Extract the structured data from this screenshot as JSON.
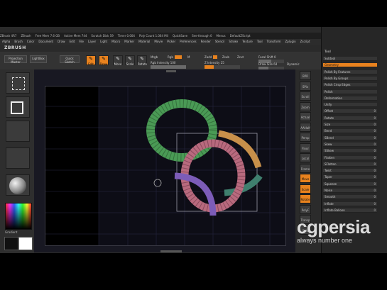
{
  "app": {
    "title_parts": [
      "ZBrush 4R7",
      "ZBrush",
      "Free Mem 7.6 GB",
      "Active Mem 744",
      "Scratch Disk 59",
      "Timer 0.004",
      "Poly Count 1.064 Mil",
      "QuickSave",
      "See-through 0",
      "Menus",
      "DefaultZScript"
    ],
    "logo": "ZBRUSH",
    "menus": [
      "Alpha",
      "Brush",
      "Color",
      "Document",
      "Draw",
      "Edit",
      "File",
      "Layer",
      "Light",
      "Macro",
      "Marker",
      "Material",
      "Movie",
      "Picker",
      "Preferences",
      "Render",
      "Stencil",
      "Stroke",
      "Texture",
      "Tool",
      "Transform",
      "Zplugin",
      "Zscript"
    ]
  },
  "top_shelf": {
    "projection_master": "Projection Master",
    "lightbox": "LightBox",
    "quick_sketch": "Quick Sketch",
    "tools": [
      {
        "label": "Edit",
        "active": true
      },
      {
        "label": "Draw",
        "active": true
      },
      {
        "label": "Move",
        "active": false
      },
      {
        "label": "Scale",
        "active": false
      },
      {
        "label": "Rotate",
        "active": false
      }
    ],
    "mrgb": "Mrgb",
    "rgb": "Rgb",
    "m": "M",
    "rgb_intensity": "Rgb Intensity 100",
    "zadd": "Zadd",
    "zsub": "Zsub",
    "zcut": "Zcut",
    "z_intensity": "Z Intensity 25",
    "focal_shift": "Focal Shift 0",
    "draw_size": "Draw Size 64",
    "dynamic": "Dynamic"
  },
  "right_tray": {
    "header": "Tool",
    "rows": [
      {
        "label": "Subtool",
        "orange": false,
        "value": ""
      },
      {
        "label": "Geometry",
        "orange": true,
        "value": ""
      },
      {
        "label": "Polish By Features",
        "orange": false,
        "value": ""
      },
      {
        "label": "Polish By Groups",
        "orange": false,
        "value": ""
      },
      {
        "label": "Polish Crisp Edges",
        "orange": false,
        "value": ""
      },
      {
        "label": "Polish",
        "orange": false,
        "value": ""
      },
      {
        "label": "Deformation",
        "orange": false,
        "value": ""
      },
      {
        "label": "Unify",
        "orange": false,
        "value": ""
      },
      {
        "label": "Offset",
        "orange": false,
        "value": "0"
      },
      {
        "label": "Rotate",
        "orange": false,
        "value": "0"
      },
      {
        "label": "Size",
        "orange": false,
        "value": "0"
      },
      {
        "label": "Bend",
        "orange": false,
        "value": "0"
      },
      {
        "label": "SBend",
        "orange": false,
        "value": "0"
      },
      {
        "label": "Skew",
        "orange": false,
        "value": "0"
      },
      {
        "label": "SSkew",
        "orange": false,
        "value": "0"
      },
      {
        "label": "Flatten",
        "orange": false,
        "value": "0"
      },
      {
        "label": "SFlatten",
        "orange": false,
        "value": "0"
      },
      {
        "label": "Twist",
        "orange": false,
        "value": "0"
      },
      {
        "label": "Taper",
        "orange": false,
        "value": "0"
      },
      {
        "label": "Squeeze",
        "orange": false,
        "value": "0"
      },
      {
        "label": "Noise",
        "orange": false,
        "value": "0"
      },
      {
        "label": "Smooth",
        "orange": false,
        "value": "0"
      },
      {
        "label": "Inflate",
        "orange": false,
        "value": "0"
      },
      {
        "label": "Inflate Balloon",
        "orange": false,
        "value": "0"
      }
    ]
  },
  "right_shelf": [
    "BPR",
    "SPix",
    "Scroll",
    "Zoom",
    "Actual",
    "AAHalf",
    "Persp",
    "Floor",
    "Local",
    "Frame",
    "Move",
    "Scale",
    "Rotate",
    "PolyF",
    "Transp",
    "Solo"
  ],
  "left_shelf": {
    "material_label": "Basic Material",
    "color_label": "Gradient"
  },
  "watermark": {
    "name": "cgpersia",
    "tagline": "always number one"
  },
  "colors": {
    "accent": "#e8821e",
    "ring_green": "#4a9a55",
    "ring_pink": "#b86a7e",
    "ring_orange": "#c8904a",
    "ring_teal": "#3f7f6e",
    "ring_purple": "#7c5cb8"
  }
}
